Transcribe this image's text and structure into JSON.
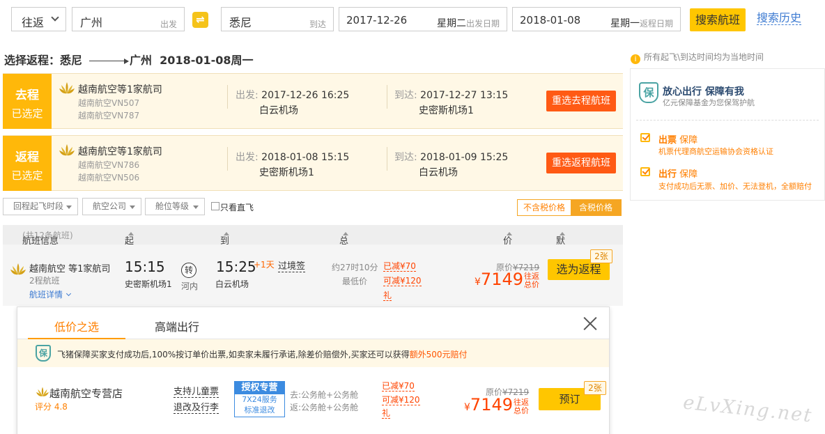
{
  "search": {
    "trip_type": "往返",
    "from_city": "广州",
    "from_tag": "出发",
    "to_city": "悉尼",
    "to_tag": "到达",
    "depart_date": "2017-12-26",
    "depart_weekday": "星期二",
    "depart_tag": "出发日期",
    "return_date": "2018-01-08",
    "return_weekday": "星期一",
    "return_tag": "返程日期",
    "search_button": "搜索航班",
    "history_link": "搜索历史"
  },
  "heading": {
    "prefix": "选择返程：悉尼",
    "dest": "广州",
    "date": "2018-01-08周一"
  },
  "outbound": {
    "tag_top": "去程",
    "tag_bottom": "已选定",
    "airline": "越南航空等1家航司",
    "flight1": "越南航空VN507",
    "flight2": "越南航空VN787",
    "depart_label": "出发:",
    "depart_time": "2017-12-26 16:25",
    "depart_airport": "白云机场",
    "arrive_label": "到达:",
    "arrive_time": "2017-12-27 13:15",
    "arrive_airport": "史密斯机场1",
    "reselect": "重选去程航班"
  },
  "returnleg": {
    "tag_top": "返程",
    "tag_bottom": "已选定",
    "airline": "越南航空等1家航司",
    "flight1": "越南航空VN786",
    "flight2": "越南航空VN506",
    "depart_label": "出发:",
    "depart_time": "2018-01-08 15:15",
    "depart_airport": "史密斯机场1",
    "arrive_label": "到达:",
    "arrive_time": "2018-01-09 15:25",
    "arrive_airport": "白云机场",
    "reselect": "重选返程航班"
  },
  "filters": {
    "takeoff": "回程起飞时段",
    "airline": "航空公司",
    "cabin": "舱位等级",
    "direct_only": "只看直飞",
    "excl_tax": "不含税价格",
    "incl_tax": "含税价格"
  },
  "sidebar": {
    "local_time_tip": "所有起飞\\到达时间均为当地时间",
    "guarantee_title": "放心出行 保障有我",
    "guarantee_sub": "亿元保障基金为您保驾护航",
    "ticket_title": "出票",
    "ticket_word": "保障",
    "ticket_desc": "机票代理商航空运输协会资格认证",
    "travel_title": "出行",
    "travel_word": "保障",
    "travel_desc": "支付成功后无票、加价、无法登机，全额赔付"
  },
  "table": {
    "col_info": "航班信息",
    "col_info_count": "(共12条航班)",
    "col_depart": "起飞时间",
    "col_arrive": "到达时间",
    "col_duration": "总耗时",
    "col_price": "价格",
    "col_sort": "默认排序"
  },
  "result": {
    "airline": "越南航空 等1家航司",
    "segments": "2程航班",
    "details": "航班详情",
    "depart_time": "15:15",
    "depart_airport": "史密斯机场1",
    "transfer_icon": "转",
    "transfer_city": "河内",
    "arrive_time": "15:25",
    "plus_day": "+1天",
    "arrive_airport": "白云机场",
    "transit_note": "过境签",
    "duration": "约27时10分",
    "lowest": "最低价",
    "discount1": "已减¥70",
    "discount2": "可减¥120",
    "gift": "礼",
    "orig_label": "原价",
    "orig_price": "¥7219",
    "currency": "¥",
    "price": "7149",
    "incl1": "往返",
    "incl2": "总价",
    "choose": "选为返程",
    "badge": "2张"
  },
  "panel": {
    "tab_low": "低价之选",
    "tab_premium": "高端出行",
    "notice_main": "飞猪保障买家支付成功后,100%按订单价出票,如卖家未履行承诺,除差价赔偿外,买家还可以获得",
    "notice_extra": "额外500元赔付",
    "shop": "越南航空专营店",
    "score": "评分 4.8",
    "policy1": "支持儿童票",
    "policy2": "退改及行李",
    "auth_head": "授权专营",
    "auth_line1": "7X24服务",
    "auth_line2": "标准退改",
    "cabin_go": "去:公务舱+公务舱",
    "cabin_back": "返:公务舱+公务舱",
    "discount1": "已减¥70",
    "discount2": "可减¥120",
    "gift": "礼",
    "orig_label": "原价",
    "orig_price": "¥7219",
    "currency": "¥",
    "price": "7149",
    "incl1": "往返",
    "incl2": "总价",
    "book": "预订",
    "badge": "2张"
  },
  "watermark": "eLvXing.net"
}
